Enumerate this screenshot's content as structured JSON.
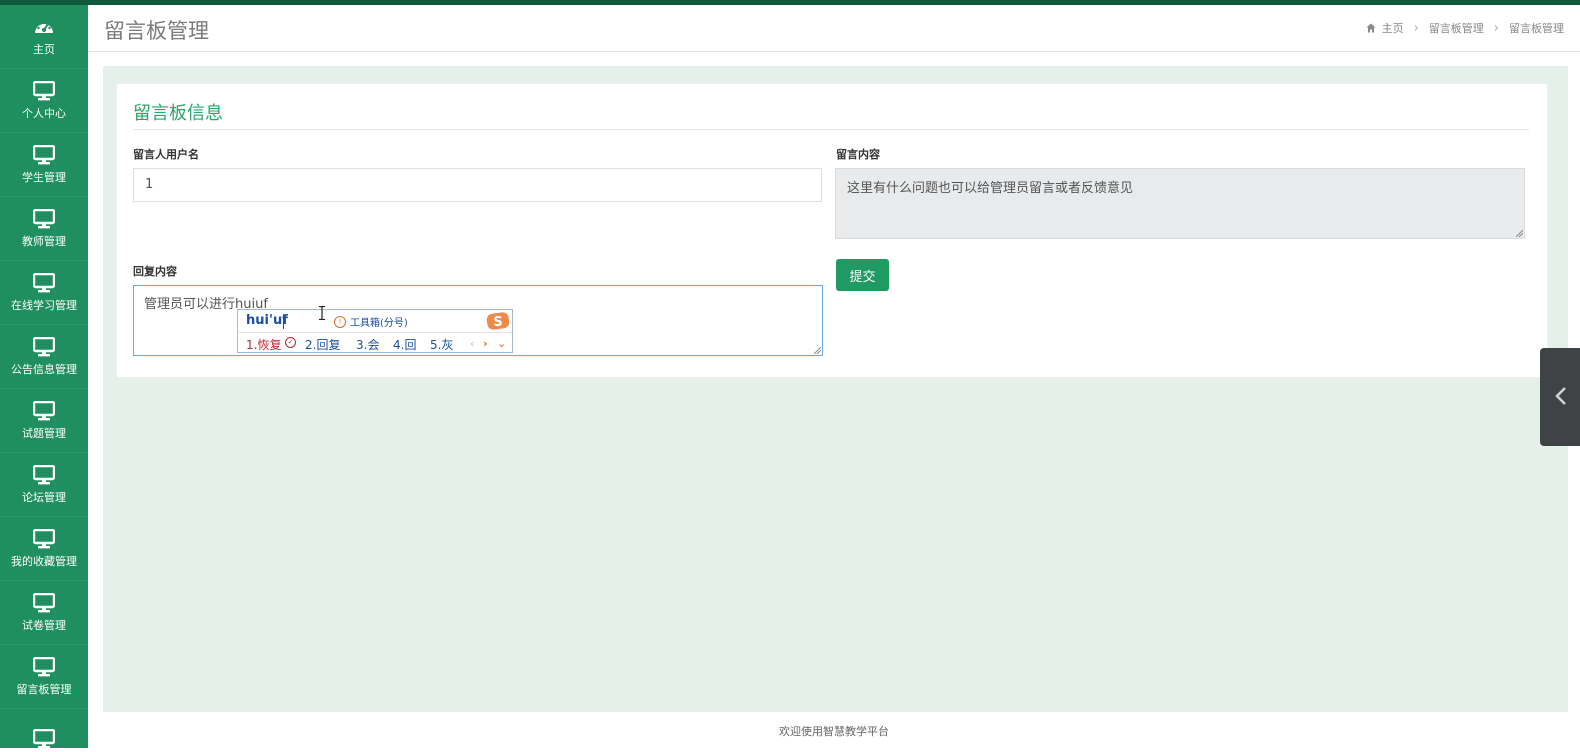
{
  "sidebar": {
    "items": [
      {
        "label": "主页",
        "icon": "dashboard-icon"
      },
      {
        "label": "个人中心",
        "icon": "monitor-icon"
      },
      {
        "label": "学生管理",
        "icon": "monitor-icon"
      },
      {
        "label": "教师管理",
        "icon": "monitor-icon"
      },
      {
        "label": "在线学习管理",
        "icon": "monitor-icon"
      },
      {
        "label": "公告信息管理",
        "icon": "monitor-icon"
      },
      {
        "label": "试题管理",
        "icon": "monitor-icon"
      },
      {
        "label": "论坛管理",
        "icon": "monitor-icon"
      },
      {
        "label": "我的收藏管理",
        "icon": "monitor-icon"
      },
      {
        "label": "试卷管理",
        "icon": "monitor-icon"
      },
      {
        "label": "留言板管理",
        "icon": "monitor-icon"
      },
      {
        "label": "",
        "icon": "monitor-icon"
      }
    ]
  },
  "header": {
    "title": "留言板管理",
    "breadcrumb": [
      "主页",
      "留言板管理",
      "留言板管理"
    ]
  },
  "panel": {
    "title": "留言板信息",
    "username_label": "留言人用户名",
    "username_value": "1",
    "content_label": "留言内容",
    "content_value": "这里有什么问题也可以给管理员留言或者反馈意见",
    "reply_label": "回复内容",
    "reply_value": "管理员可以进行huiuf",
    "submit_label": "提交"
  },
  "ime": {
    "composition": "hui'uf",
    "toolbox": "工具箱(分号)",
    "candidates": [
      "1.恢复",
      "2.回复",
      "3.会",
      "4.回",
      "5.灰"
    ]
  },
  "footer": {
    "text": "欢迎使用智慧教学平台"
  },
  "colors": {
    "sidebar_bg": "#1f8f5f",
    "accent_green": "#2fa36b",
    "submit_bg": "#1f9a62",
    "content_bg": "#e6f0ea"
  }
}
